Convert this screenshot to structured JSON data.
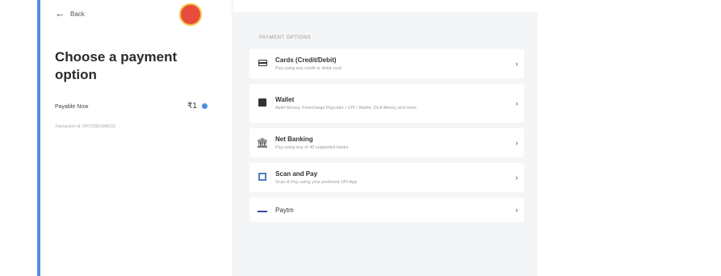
{
  "left_panel": {
    "back_label": "Back",
    "logo_text": "",
    "title": "Choose a payment option",
    "payable_label": "Payable Now",
    "payable_amount": "₹1",
    "transaction_id": "Transaction id: 9HCH2801988116"
  },
  "main": {
    "section_label": "PAYMENT OPTIONS",
    "options": [
      {
        "title": "Cards (Credit/Debit)",
        "subtitle": "Pay using any credit or debit card",
        "icon": "card-icon"
      },
      {
        "title": "Wallet",
        "subtitle": "Airtel Money, Freecharge PayLater / UPI / Wallet, OLA Money and more",
        "icon": "wallet-icon"
      },
      {
        "title": "Net Banking",
        "subtitle": "Pay using any of 40 supported banks",
        "icon": "bank-icon"
      },
      {
        "title": "Scan and Pay",
        "subtitle": "Scan & Pay using your preferred UPI App",
        "icon": "qr-scan-icon"
      },
      {
        "title": "Paytm",
        "subtitle": "",
        "icon": "paytm-logo-icon"
      }
    ],
    "chevron": "›"
  },
  "colors": {
    "accent": "#4a90e2",
    "main_background": "#f4f5f6"
  }
}
